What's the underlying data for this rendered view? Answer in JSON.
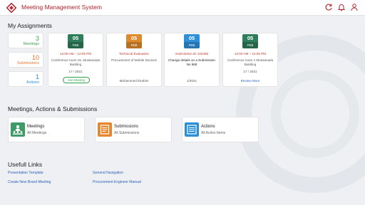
{
  "header": {
    "title": "Meeting Management System"
  },
  "assignments": {
    "title": "My Assignments",
    "counters": [
      {
        "count": "3",
        "label": "Meetings",
        "color": "#3fa34d"
      },
      {
        "count": "10",
        "label": "Submissions",
        "color": "#e8742f"
      },
      {
        "count": "1",
        "label": "Actions",
        "color": "#2a8fd6"
      }
    ],
    "cards": [
      {
        "day": "05",
        "month": "FEB",
        "color": "#2e7d5b",
        "line1": "12:00 AM – 12:05 PM",
        "line2": "Conference room 15, Mussanada Building",
        "line3": "17 / 2021",
        "button": "Join Meeting"
      },
      {
        "day": "05",
        "month": "FEB",
        "color": "#e08a2d",
        "line1": "Technical Evaluation",
        "line2": "Procurement of Mobile Devices",
        "line3": "Mohammed Ibrahim"
      },
      {
        "day": "05",
        "month": "FEB",
        "color": "#2f8fd8",
        "line1": "Submission ID 102455",
        "line2": "Change details on a Submission No 568",
        "line3": "1/2021"
      },
      {
        "day": "05",
        "month": "FEB",
        "color": "#2e7d5b",
        "line1": "12:00 AM – 12:05 PM",
        "line2": "Conference room 1 Mussanada Building",
        "line3": "17 / 2021",
        "link": "Review More"
      }
    ]
  },
  "mas": {
    "title": "Meetings, Actions & Submissions",
    "tiles": [
      {
        "title": "Meetings",
        "subtitle": "All Meetings",
        "color": "#3e9a66",
        "icon": "meeting-icon"
      },
      {
        "title": "Submissions",
        "subtitle": "All Submissions",
        "color": "#e8862f",
        "icon": "document-icon"
      },
      {
        "title": "Actions",
        "subtitle": "All Action Items",
        "color": "#2a8fd6",
        "icon": "list-icon"
      }
    ]
  },
  "links": {
    "title": "Usefull Links",
    "items": [
      "Presentation Template",
      "General Navigation",
      "Create New Board Meeting",
      "Procurement Engineer Manual"
    ]
  }
}
